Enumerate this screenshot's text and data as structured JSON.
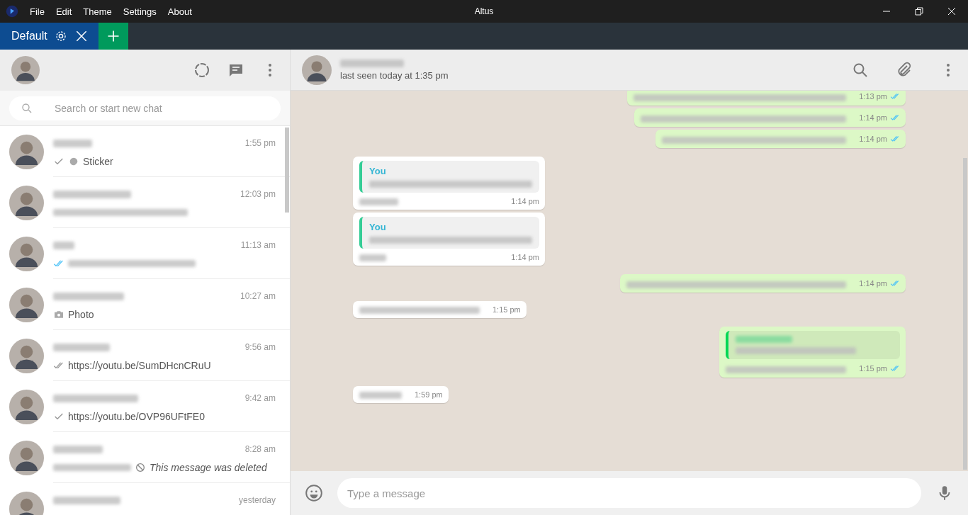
{
  "window": {
    "title": "Altus",
    "menu": [
      "File",
      "Edit",
      "Theme",
      "Settings",
      "About"
    ]
  },
  "tabs": [
    {
      "label": "Default",
      "selected": true
    }
  ],
  "sidebar": {
    "search": {
      "placeholder": "Search or start new chat"
    },
    "chats": [
      {
        "time": "1:55 pm",
        "kind": "sticker",
        "preview": "Sticker"
      },
      {
        "time": "12:03 pm",
        "kind": "blurred"
      },
      {
        "time": "11:13 am",
        "kind": "read"
      },
      {
        "time": "10:27 am",
        "kind": "photo",
        "preview": "Photo"
      },
      {
        "time": "9:56 am",
        "kind": "delivered",
        "preview": "https://youtu.be/SumDHcnCRuU"
      },
      {
        "time": "9:42 am",
        "kind": "sent",
        "preview": "https://youtu.be/OVP96UFtFE0"
      },
      {
        "time": "8:28 am",
        "kind": "deleted",
        "preview": "This message was deleted"
      },
      {
        "time": "yesterday",
        "kind": "clipped"
      }
    ]
  },
  "conversation": {
    "status": "last seen today at 1:35 pm",
    "messages": [
      {
        "kind": "outgoing",
        "time": "1:13 pm",
        "read": true
      },
      {
        "kind": "outgoing",
        "time": "1:14 pm",
        "read": true
      },
      {
        "kind": "outgoing",
        "time": "1:14 pm",
        "read": true
      },
      {
        "kind": "incoming_reply",
        "time": "1:14 pm",
        "quote_author": "You"
      },
      {
        "kind": "incoming_reply",
        "time": "1:14 pm",
        "quote_author": "You"
      },
      {
        "kind": "outgoing",
        "time": "1:14 pm",
        "read": true
      },
      {
        "kind": "incoming",
        "time": "1:15 pm"
      },
      {
        "kind": "outgoing_reply",
        "time": "1:15 pm",
        "read": true
      },
      {
        "kind": "incoming",
        "time": "1:59 pm"
      }
    ],
    "composer": {
      "placeholder": "Type a message"
    }
  }
}
